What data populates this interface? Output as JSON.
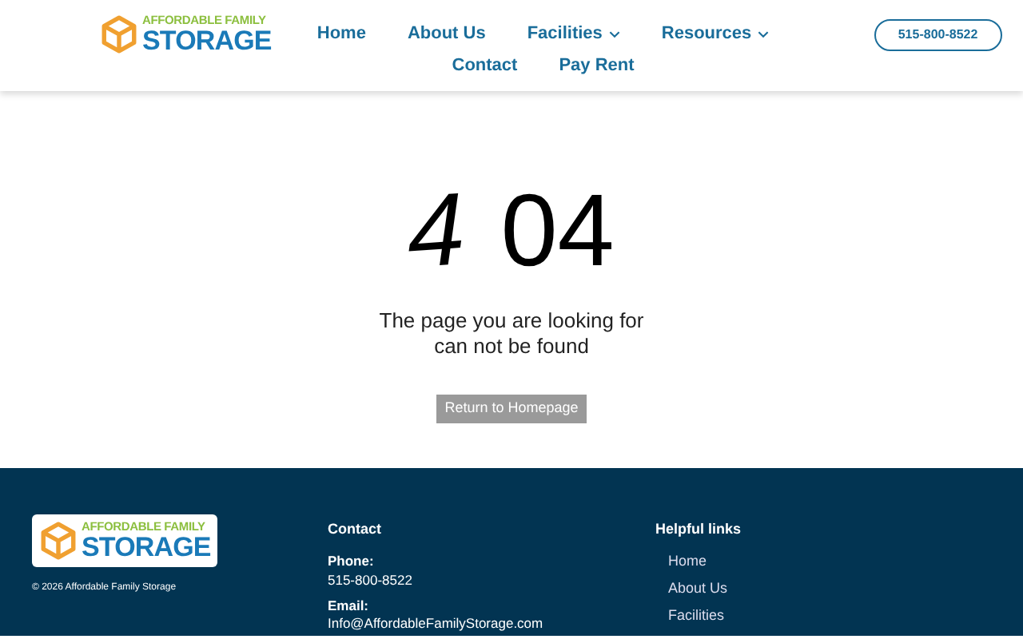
{
  "header": {
    "logo": {
      "top": "AFFORDABLE FAMILY",
      "bottom": "STORAGE"
    },
    "nav": [
      {
        "label": "Home",
        "has_menu": false
      },
      {
        "label": "About Us",
        "has_menu": false
      },
      {
        "label": "Facilities",
        "has_menu": true
      },
      {
        "label": "Resources",
        "has_menu": true
      },
      {
        "label": "Contact",
        "has_menu": false
      },
      {
        "label": "Pay Rent",
        "has_menu": false
      }
    ],
    "phone_button": "515-800-8522"
  },
  "error": {
    "code_tilted": "4",
    "code_rest": "04",
    "message_line_1": "The page you are looking for",
    "message_line_2": "can not be found",
    "button": "Return to Homepage"
  },
  "footer": {
    "logo": {
      "top": "AFFORDABLE FAMILY",
      "bottom": "STORAGE"
    },
    "copyright": "© 2026 Affordable Family Storage",
    "contact": {
      "heading": "Contact",
      "phone_label": "Phone:",
      "phone": "515-800-8522",
      "email_label": "Email:",
      "email": "Info@AffordableFamilyStorage.com"
    },
    "links": {
      "heading": "Helpful links",
      "items": [
        "Home",
        "About Us",
        "Facilities"
      ]
    }
  }
}
